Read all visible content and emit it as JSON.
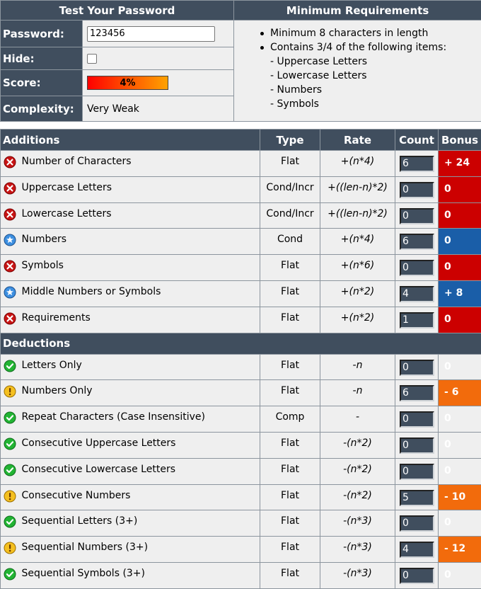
{
  "header": {
    "test_title": "Test Your Password",
    "req_title": "Minimum Requirements"
  },
  "form": {
    "password_label": "Password:",
    "password_value": "123456",
    "hide_label": "Hide:",
    "score_label": "Score:",
    "score_value": "4%",
    "score_fraction": 0.04,
    "complexity_label": "Complexity:",
    "complexity_value": "Very Weak"
  },
  "requirements": {
    "items": [
      "Minimum 8 characters in length",
      "Contains 3/4 of the following items:"
    ],
    "subitems": [
      "- Uppercase Letters",
      "- Lowercase Letters",
      "- Numbers",
      "- Symbols"
    ]
  },
  "columns": {
    "additions": "Additions",
    "type": "Type",
    "rate": "Rate",
    "count": "Count",
    "bonus": "Bonus",
    "deductions": "Deductions"
  },
  "colors": {
    "fail": "#cc0000",
    "pass": "#1a5ea8",
    "exceed": "#1a8f2e",
    "warn": "#f26b0c",
    "header": "#404e5e"
  },
  "additions": [
    {
      "status": "fail",
      "icon": "x-circle-icon",
      "name": "Number of Characters",
      "type": "Flat",
      "rate": "+(n*4)",
      "count": "6",
      "bonus": "+ 24"
    },
    {
      "status": "fail",
      "icon": "x-circle-icon",
      "name": "Uppercase Letters",
      "type": "Cond/Incr",
      "rate": "+((len-n)*2)",
      "count": "0",
      "bonus": "0"
    },
    {
      "status": "fail",
      "icon": "x-circle-icon",
      "name": "Lowercase Letters",
      "type": "Cond/Incr",
      "rate": "+((len-n)*2)",
      "count": "0",
      "bonus": "0"
    },
    {
      "status": "pass",
      "icon": "star-circle-icon",
      "name": "Numbers",
      "type": "Cond",
      "rate": "+(n*4)",
      "count": "6",
      "bonus": "0"
    },
    {
      "status": "fail",
      "icon": "x-circle-icon",
      "name": "Symbols",
      "type": "Flat",
      "rate": "+(n*6)",
      "count": "0",
      "bonus": "0"
    },
    {
      "status": "pass",
      "icon": "star-circle-icon",
      "name": "Middle Numbers or Symbols",
      "type": "Flat",
      "rate": "+(n*2)",
      "count": "4",
      "bonus": "+ 8"
    },
    {
      "status": "fail",
      "icon": "x-circle-icon",
      "name": "Requirements",
      "type": "Flat",
      "rate": "+(n*2)",
      "count": "1",
      "bonus": "0"
    }
  ],
  "deductions": [
    {
      "status": "exceed",
      "icon": "check-circle-icon",
      "name": "Letters Only",
      "type": "Flat",
      "rate": "-n",
      "count": "0",
      "bonus": "0"
    },
    {
      "status": "warn",
      "icon": "warning-circle-icon",
      "name": "Numbers Only",
      "type": "Flat",
      "rate": "-n",
      "count": "6",
      "bonus": "- 6"
    },
    {
      "status": "exceed",
      "icon": "check-circle-icon",
      "name": "Repeat Characters (Case Insensitive)",
      "type": "Comp",
      "rate": "-",
      "count": "0",
      "bonus": "0"
    },
    {
      "status": "exceed",
      "icon": "check-circle-icon",
      "name": "Consecutive Uppercase Letters",
      "type": "Flat",
      "rate": "-(n*2)",
      "count": "0",
      "bonus": "0"
    },
    {
      "status": "exceed",
      "icon": "check-circle-icon",
      "name": "Consecutive Lowercase Letters",
      "type": "Flat",
      "rate": "-(n*2)",
      "count": "0",
      "bonus": "0"
    },
    {
      "status": "warn",
      "icon": "warning-circle-icon",
      "name": "Consecutive Numbers",
      "type": "Flat",
      "rate": "-(n*2)",
      "count": "5",
      "bonus": "- 10"
    },
    {
      "status": "exceed",
      "icon": "check-circle-icon",
      "name": "Sequential Letters (3+)",
      "type": "Flat",
      "rate": "-(n*3)",
      "count": "0",
      "bonus": "0"
    },
    {
      "status": "warn",
      "icon": "warning-circle-icon",
      "name": "Sequential Numbers (3+)",
      "type": "Flat",
      "rate": "-(n*3)",
      "count": "4",
      "bonus": "- 12"
    },
    {
      "status": "exceed",
      "icon": "check-circle-icon",
      "name": "Sequential Symbols (3+)",
      "type": "Flat",
      "rate": "-(n*3)",
      "count": "0",
      "bonus": "0"
    }
  ]
}
